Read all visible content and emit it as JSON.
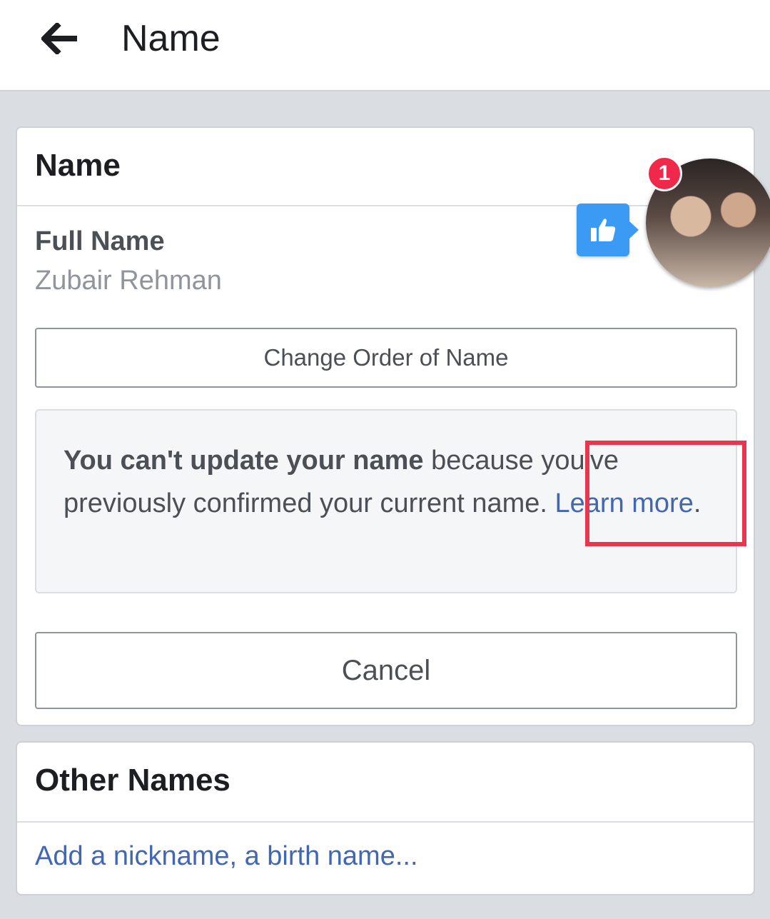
{
  "header": {
    "back_icon": "arrow-left-icon",
    "title": "Name"
  },
  "name_card": {
    "title": "Name",
    "full_name_label": "Full Name",
    "full_name_value": "Zubair Rehman",
    "change_order_label": "Change Order of Name",
    "notice": {
      "bold": "You can't update your name",
      "text": " because you've previously confirmed your current name. ",
      "link": "Learn more",
      "end": "."
    },
    "cancel_label": "Cancel"
  },
  "other_names_card": {
    "title": "Other Names",
    "add_link": "Add a nickname, a birth name..."
  },
  "chat_head": {
    "badge_count": "1",
    "like_icon": "thumbs-up-icon"
  },
  "colors": {
    "link": "#4267b2",
    "badge": "#f02849",
    "like_bubble": "#3b9bf4",
    "highlight": "#e8364f"
  }
}
